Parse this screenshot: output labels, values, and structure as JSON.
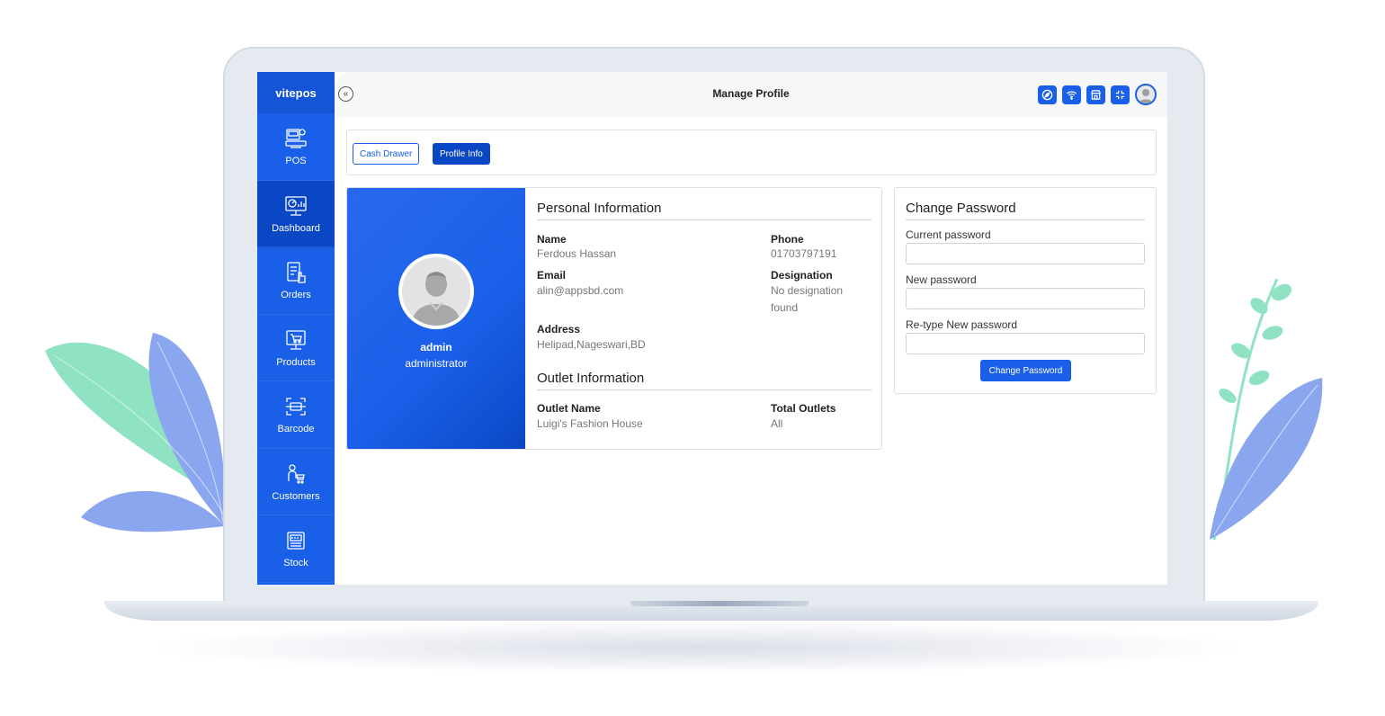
{
  "brand": {
    "name": "vitepos"
  },
  "sidebar": {
    "items": [
      {
        "label": "POS",
        "icon": "pos-terminal-icon",
        "active": false
      },
      {
        "label": "Dashboard",
        "icon": "dashboard-monitor-icon",
        "active": true
      },
      {
        "label": "Orders",
        "icon": "orders-list-icon",
        "active": false
      },
      {
        "label": "Products",
        "icon": "products-cart-icon",
        "active": false
      },
      {
        "label": "Barcode",
        "icon": "barcode-scan-icon",
        "active": false
      },
      {
        "label": "Customers",
        "icon": "customers-icon",
        "active": false
      },
      {
        "label": "Stock",
        "icon": "stock-icon",
        "active": false
      }
    ]
  },
  "header": {
    "collapse_glyph": "«",
    "title": "Manage Profile",
    "icons": [
      "compass-icon",
      "wifi-icon",
      "store-icon",
      "fullscreen-exit-icon",
      "user-avatar-icon"
    ]
  },
  "tabs": {
    "cash_drawer": "Cash Drawer",
    "profile_info": "Profile Info",
    "active": "Profile Info"
  },
  "profile": {
    "username": "admin",
    "role": "administrator",
    "personal_title": "Personal Information",
    "name_label": "Name",
    "name_value": "Ferdous Hassan",
    "phone_label": "Phone",
    "phone_value": "01703797191",
    "email_label": "Email",
    "email_value": "alin@appsbd.com",
    "designation_label": "Designation",
    "designation_value": "No designation found",
    "address_label": "Address",
    "address_value": "Helipad,Nageswari,BD",
    "outlet_title": "Outlet Information",
    "outlet_name_label": "Outlet Name",
    "outlet_name_value": "Luigi's Fashion House",
    "total_outlets_label": "Total Outlets",
    "total_outlets_value": "All"
  },
  "password": {
    "title": "Change Password",
    "current_label": "Current password",
    "current_value": "",
    "new_label": "New password",
    "new_value": "",
    "retype_label": "Re-type New password",
    "retype_value": "",
    "button_label": "Change Password"
  },
  "colors": {
    "primary": "#1a5fe8",
    "primary_dark": "#0a47c4",
    "leaf_green": "#8fe3c2",
    "leaf_blue": "#8aa6ee"
  }
}
